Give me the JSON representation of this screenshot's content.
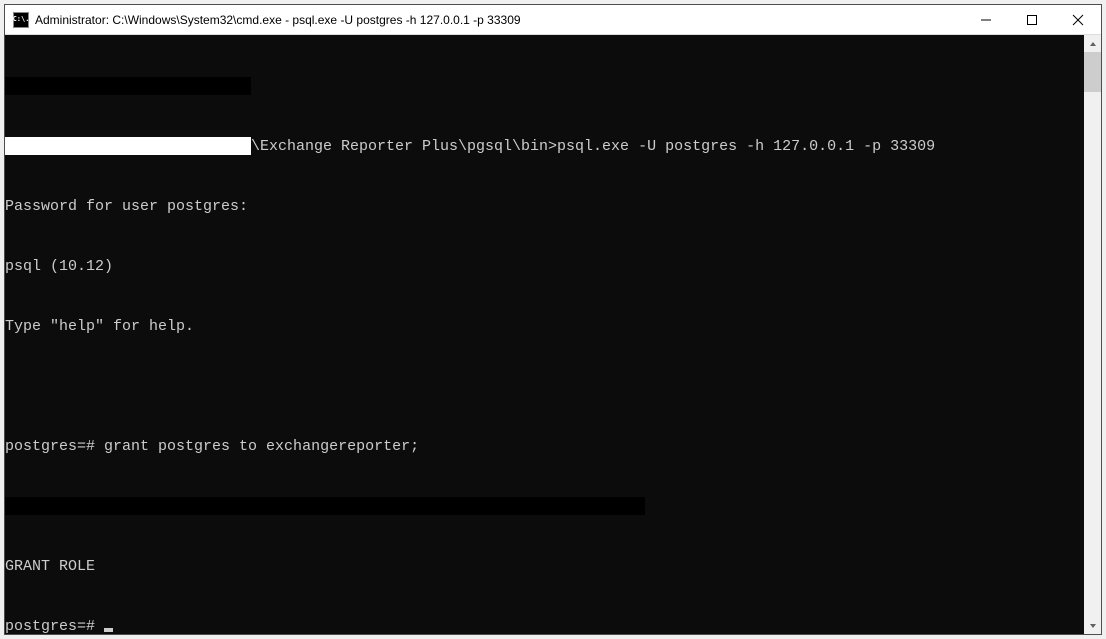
{
  "window": {
    "title": "Administrator: C:\\Windows\\System32\\cmd.exe - psql.exe  -U postgres -h 127.0.0.1 -p 33309",
    "icon_label": "C:\\."
  },
  "controls": {
    "minimize": "minimize",
    "maximize": "maximize",
    "close": "close"
  },
  "terminal": {
    "line1_suffix": "\\Exchange Reporter Plus\\pgsql\\bin>psql.exe -U postgres -h 127.0.0.1 -p 33309",
    "line2": "Password for user postgres:",
    "line3": "psql (10.12)",
    "line4": "Type \"help\" for help.",
    "line5_prompt": "postgres=# ",
    "line5_cmd": "grant postgres to exchangereporter;",
    "line6": "GRANT ROLE",
    "line7_prompt": "postgres=# "
  }
}
